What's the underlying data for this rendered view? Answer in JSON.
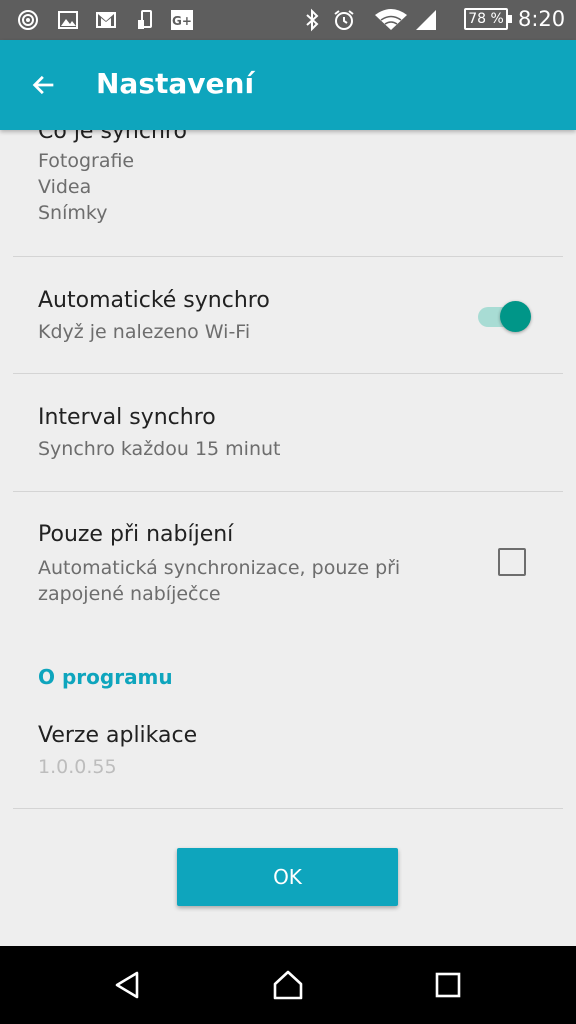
{
  "status_bar": {
    "battery_percent": "78 %",
    "time": "8:20"
  },
  "app_bar": {
    "title": "Nastavení"
  },
  "preferences": {
    "sync_content": {
      "title": "Co je synchro",
      "items": [
        "Fotografie",
        "Videa",
        "Snímky"
      ]
    },
    "auto_sync": {
      "title": "Automatické synchro",
      "summary": "Když je nalezeno Wi-Fi",
      "enabled": true
    },
    "sync_interval": {
      "title": "Interval synchro",
      "summary": "Synchro každou 15 minut"
    },
    "charging_only": {
      "title": "Pouze při nabíjení",
      "summary_line1": "Automatická synchronizace, pouze při",
      "summary_line2": "zapojené nabíječce",
      "checked": false
    },
    "about_category": "O programu",
    "app_version": {
      "title": "Verze aplikace",
      "value": "1.0.0.55"
    }
  },
  "ok_button_label": "OK",
  "colors": {
    "accent": "#0ea5bd",
    "switch_on": "#009688"
  }
}
